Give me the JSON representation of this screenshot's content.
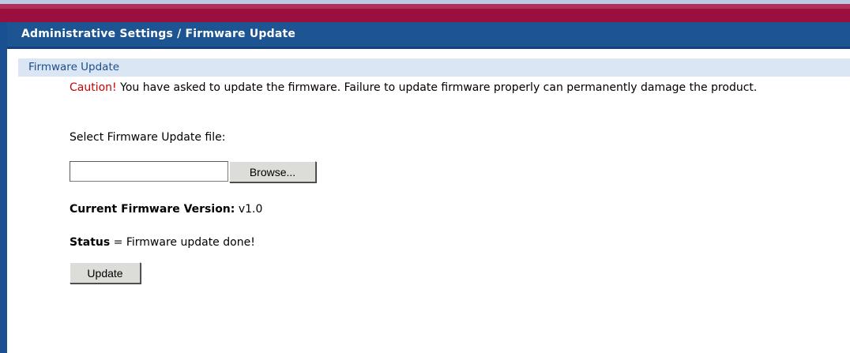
{
  "header": {
    "title": "Administrative Settings / Firmware Update"
  },
  "section": {
    "title": "Firmware Update"
  },
  "warning": {
    "caution_label": "Caution!",
    "message": " You have asked to update the firmware. Failure to update firmware properly can permanently damage the product."
  },
  "file_select": {
    "label": "Select Firmware Update file:",
    "input_value": "",
    "browse_label": "Browse..."
  },
  "firmware": {
    "version_label": "Current Firmware Version:",
    "version_value": " v1.0"
  },
  "status": {
    "label": "Status",
    "separator": " = ",
    "value": "Firmware update done!"
  },
  "actions": {
    "update_label": "Update"
  },
  "colors": {
    "header_blue": "#1d5592",
    "accent_maroon": "#9a0f3d",
    "section_bg": "#dbe6f4",
    "caution_red": "#cc0000"
  }
}
